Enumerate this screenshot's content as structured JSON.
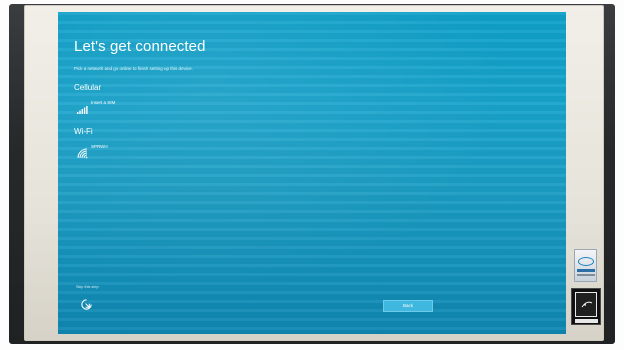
{
  "setup": {
    "title": "Let's get connected",
    "subtitle": "Pick a network and go online to finish setting up this device.",
    "sections": {
      "cellular": {
        "heading": "Cellular",
        "item_label": "Insert a SIM",
        "icon": "cellular-signal-icon"
      },
      "wifi": {
        "heading": "Wi-Fi",
        "item_label": "SPRWH",
        "icon": "wifi-signal-icon"
      }
    },
    "skip_link": "Skip this step",
    "accessibility_icon": "ease-of-access-icon",
    "back_button": "Back"
  },
  "colors": {
    "screen_background": "#1b9dc3",
    "button_background": "#3fb7de",
    "text": "#ffffff",
    "bezel": "#2b2d30",
    "frame": "#ece9e1"
  },
  "stickers": {
    "processor_badge": "intel-badge-icon",
    "energy_badge": "energy-star-icon"
  }
}
